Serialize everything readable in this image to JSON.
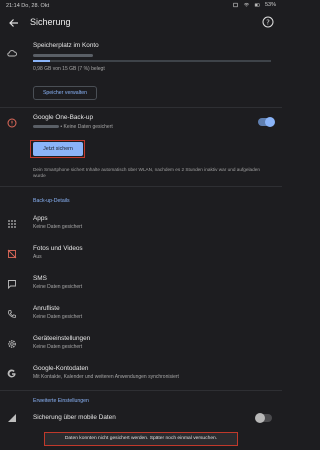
{
  "status_bar": {
    "time": "21:14",
    "date": "Do, 28. Okt",
    "battery": "53%"
  },
  "app_bar": {
    "title": "Sicherung"
  },
  "storage": {
    "title": "Speicherplatz im Konto",
    "usage_text": "0,98 GB von 15 GB (7 %) belegt",
    "used_fraction": 0.07,
    "manage_label": "Speicher verwalten"
  },
  "one_backup": {
    "title": "Google One-Back-up",
    "subtitle": "• Keine Daten gesichert",
    "toggle_on": true,
    "backup_now_label": "Jetzt sichern",
    "info_text": "Dein Smartphone sichert Inhalte automatisch über WLAN, nachdem es 2 Stunden inaktiv war und aufgeladen wurde"
  },
  "details": {
    "section_title": "Back-up-Details",
    "items": [
      {
        "title": "Apps",
        "subtitle": "Keine Daten gesichert"
      },
      {
        "title": "Fotos und Videos",
        "subtitle": "Aus"
      },
      {
        "title": "SMS",
        "subtitle": "Keine Daten gesichert"
      },
      {
        "title": "Anrufliste",
        "subtitle": "Keine Daten gesichert"
      },
      {
        "title": "Geräteeinstellungen",
        "subtitle": "Keine Daten gesichert"
      },
      {
        "title": "Google-Kontodaten",
        "subtitle": "Mit Kontakte, Kalender und weiteren Anwendungen synchronisiert"
      }
    ]
  },
  "advanced": {
    "section_title": "Erweiterte Einstellungen",
    "mobile_backup_label": "Sicherung über mobile Daten",
    "mobile_backup_on": false
  },
  "snackbar": {
    "message": "Daten konnten nicht gesichert werden. Später noch einmal versuchen."
  },
  "colors": {
    "accent": "#8ab4f8",
    "background": "#1d1d20",
    "warning": "#e06a5a",
    "highlight_border": "#c0392b"
  }
}
